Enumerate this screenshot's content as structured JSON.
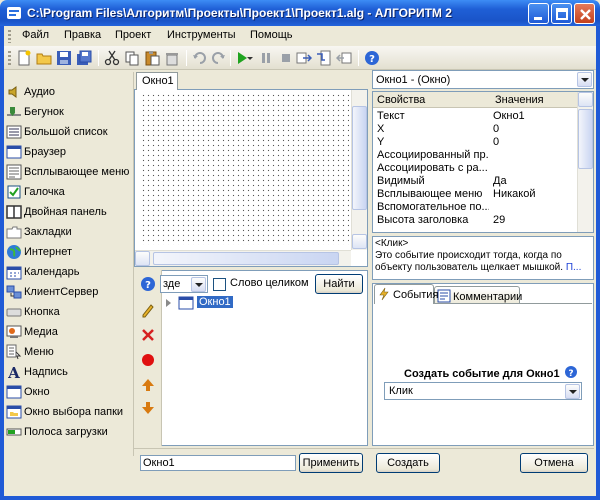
{
  "window": {
    "title": "C:\\Program Files\\Алгоритм\\Проекты\\Проект1\\Проект1.alg - АЛГОРИТМ 2"
  },
  "menu": [
    "Файл",
    "Правка",
    "Проект",
    "Инструменты",
    "Помощь"
  ],
  "palette": [
    {
      "label": "Аудио",
      "icon": "audio-icon"
    },
    {
      "label": "Бегунок",
      "icon": "slider-icon"
    },
    {
      "label": "Большой список",
      "icon": "list-icon"
    },
    {
      "label": "Браузер",
      "icon": "browser-icon"
    },
    {
      "label": "Всплывающее меню",
      "icon": "popup-menu-icon"
    },
    {
      "label": "Галочка",
      "icon": "checkbox-icon"
    },
    {
      "label": "Двойная панель",
      "icon": "split-panel-icon"
    },
    {
      "label": "Закладки",
      "icon": "tabs-icon"
    },
    {
      "label": "Интернет",
      "icon": "globe-icon"
    },
    {
      "label": "Календарь",
      "icon": "calendar-icon"
    },
    {
      "label": "КлиентСервер",
      "icon": "client-server-icon"
    },
    {
      "label": "Кнопка",
      "icon": "button-icon"
    },
    {
      "label": "Медиа",
      "icon": "media-icon"
    },
    {
      "label": "Меню",
      "icon": "menu-icon"
    },
    {
      "label": "Надпись",
      "icon": "label-icon"
    },
    {
      "label": "Окно",
      "icon": "window-icon"
    },
    {
      "label": "Окно выбора папки",
      "icon": "folder-dialog-icon"
    },
    {
      "label": "Полоса загрузки",
      "icon": "progress-bar-icon"
    }
  ],
  "designer": {
    "tab": "Окно1"
  },
  "properties": {
    "object": "Окно1 - (Окно)",
    "col_name": "Свойства",
    "col_value": "Значения",
    "rows": [
      {
        "name": "Текст",
        "value": "Окно1"
      },
      {
        "name": "X",
        "value": "0"
      },
      {
        "name": "Y",
        "value": "0"
      },
      {
        "name": "Ассоциированный пр...",
        "value": ""
      },
      {
        "name": "Ассоциировать с ра...",
        "value": ""
      },
      {
        "name": "Видимый",
        "value": "Да"
      },
      {
        "name": "Всплывающее меню",
        "value": "Никакой"
      },
      {
        "name": "Вспомогательное по...",
        "value": ""
      },
      {
        "name": "Высота заголовка",
        "value": "29"
      }
    ]
  },
  "description": {
    "event": "<Клик>",
    "text": "Это событие происходит тогда, когда по объекту пользователь  щелкает мышкой.",
    "more": "П..."
  },
  "search": {
    "scope": "зде",
    "whole_word": "Слово целиком",
    "find_button": "Найти"
  },
  "tree": {
    "node": "Окно1"
  },
  "events_pane": {
    "tab_events": "События",
    "tab_comments": "Комментарии",
    "create_label": "Создать событие для Окно1",
    "event_value": "Клик"
  },
  "bottom": {
    "name_value": "Окно1",
    "apply_button": "Применить",
    "create_button": "Создать",
    "cancel_button": "Отмена"
  }
}
